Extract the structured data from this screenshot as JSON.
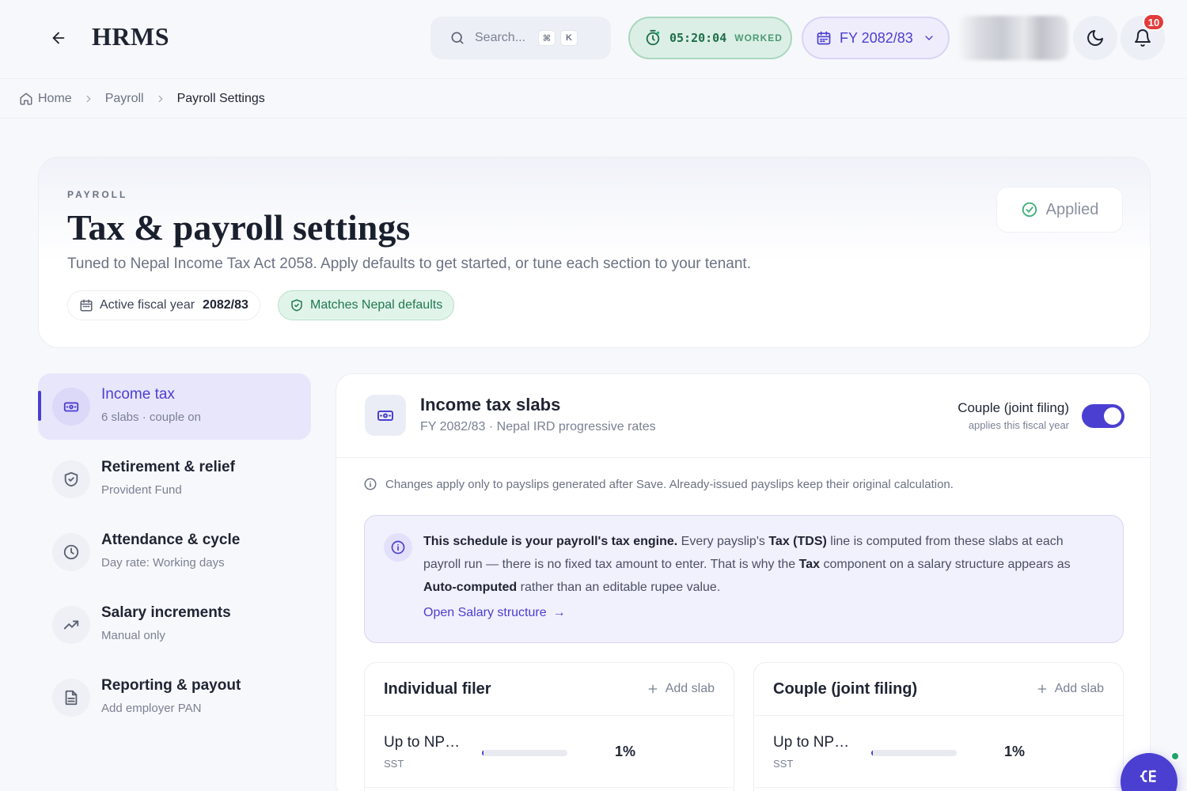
{
  "header": {
    "brand": "HRMS",
    "search_placeholder": "Search...",
    "search_kbd_1": "⌘",
    "search_kbd_2": "K",
    "timer_value": "05:20:04",
    "timer_label": "WORKED",
    "fiscal_year": "FY 2082/83",
    "notification_count": "10"
  },
  "breadcrumb": {
    "home": "Home",
    "payroll": "Payroll",
    "current": "Payroll Settings"
  },
  "hero": {
    "eyebrow": "PAYROLL",
    "title": "Tax & payroll settings",
    "subtitle": "Tuned to Nepal Income Tax Act 2058. Apply defaults to get started, or tune each section to your tenant.",
    "active_fy_label": "Active fiscal year",
    "active_fy_value": "2082/83",
    "defaults_badge": "Matches Nepal defaults",
    "applied_label": "Applied"
  },
  "nav": [
    {
      "title": "Income tax",
      "sub": "6 slabs · couple on",
      "icon": "card-icon"
    },
    {
      "title": "Retirement & relief",
      "sub": "Provident Fund",
      "icon": "shield-icon"
    },
    {
      "title": "Attendance & cycle",
      "sub": "Day rate: Working days",
      "icon": "clock-icon"
    },
    {
      "title": "Salary increments",
      "sub": "Manual only",
      "icon": "trend-icon"
    },
    {
      "title": "Reporting & payout",
      "sub": "Add employer PAN",
      "icon": "document-icon"
    }
  ],
  "panel": {
    "title": "Income tax slabs",
    "subtitle": "FY 2082/83 · Nepal IRD progressive rates",
    "joint_label": "Couple (joint filing)",
    "joint_sub": "applies this fiscal year",
    "joint_enabled": true,
    "note": "Changes apply only to payslips generated after Save. Already-issued payslips keep their original calculation.",
    "callout": {
      "strong_1": "This schedule is your payroll's tax engine.",
      "text_1": " Every payslip's ",
      "strong_2": "Tax (TDS)",
      "text_2": " line is computed from these slabs at each payroll run — there is no fixed tax amount to enter. That is why the ",
      "strong_3": "Tax",
      "text_3": " component on a salary structure appears as ",
      "strong_4": "Auto-computed",
      "text_4": " rather than an editable rupee value.",
      "link": "Open Salary structure",
      "link_arrow": "→"
    },
    "individual": {
      "title": "Individual filer",
      "add_label": "Add slab",
      "rows": [
        {
          "label": "Up to NP…",
          "sub": "SST",
          "rate": "1%",
          "level": 0.02
        }
      ]
    },
    "couple": {
      "title": "Couple (joint filing)",
      "add_label": "Add slab",
      "rows": [
        {
          "label": "Up to NP…",
          "sub": "SST",
          "rate": "1%",
          "level": 0.02
        }
      ]
    }
  },
  "colors": {
    "accent": "#4b3fd1",
    "success": "#1f7a50",
    "danger": "#e23b3b"
  }
}
